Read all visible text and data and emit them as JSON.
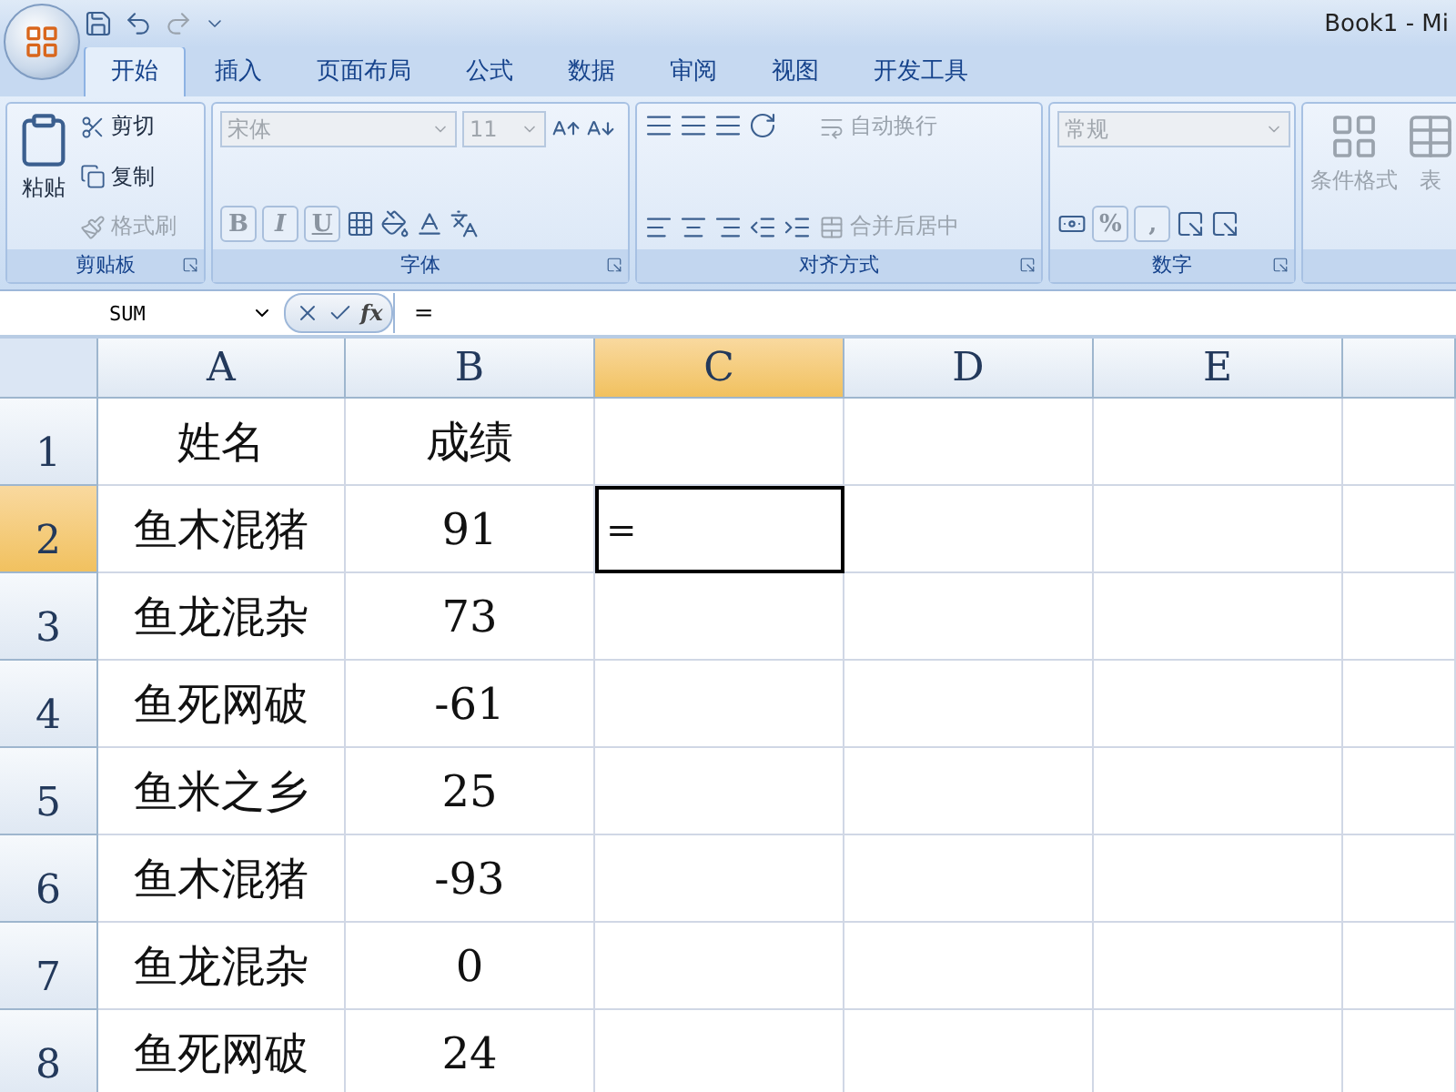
{
  "window": {
    "title": "Book1 - Mi"
  },
  "ribbon": {
    "tabs": [
      {
        "label": "开始",
        "selected": true
      },
      {
        "label": "插入",
        "selected": false
      },
      {
        "label": "页面布局",
        "selected": false
      },
      {
        "label": "公式",
        "selected": false
      },
      {
        "label": "数据",
        "selected": false
      },
      {
        "label": "审阅",
        "selected": false
      },
      {
        "label": "视图",
        "selected": false
      },
      {
        "label": "开发工具",
        "selected": false
      }
    ],
    "groups": [
      {
        "kind": "clipboard",
        "label": "剪贴板",
        "paste": "粘贴",
        "items": [
          {
            "label": "剪切",
            "disabled": false
          },
          {
            "label": "复制",
            "disabled": false
          },
          {
            "label": "格式刷",
            "disabled": true
          }
        ]
      },
      {
        "kind": "font",
        "label": "字体",
        "font": "宋体",
        "size": "11",
        "buttons": [
          "B",
          "I",
          "U"
        ],
        "disabled": true
      },
      {
        "kind": "alignment",
        "label": "对齐方式",
        "items": [
          {
            "label": "自动换行",
            "disabled": true
          },
          {
            "label": "合并后居中",
            "disabled": true
          }
        ]
      },
      {
        "kind": "number",
        "label": "数字",
        "format": "常规",
        "buttons": [
          "%",
          ","
        ],
        "disabled": true
      },
      {
        "kind": "styles",
        "items": [
          {
            "label": "条件格式",
            "disabled": true
          },
          {
            "label": "表",
            "disabled": true
          }
        ]
      }
    ]
  },
  "formula_bar": {
    "name_box": "SUM",
    "function_button": "fx",
    "value": "="
  },
  "sheet": {
    "columns": [
      {
        "label": "A",
        "selected": false
      },
      {
        "label": "B",
        "selected": false
      },
      {
        "label": "C",
        "selected": true
      },
      {
        "label": "D",
        "selected": false
      },
      {
        "label": "E",
        "selected": false
      }
    ],
    "rows": [
      {
        "number": "1",
        "selected": false,
        "cells": [
          "姓名",
          "成绩"
        ]
      },
      {
        "number": "2",
        "selected": true,
        "cells": [
          "鱼木混猪",
          "91",
          "="
        ]
      },
      {
        "number": "3",
        "selected": false,
        "cells": [
          "鱼龙混杂",
          "73"
        ]
      },
      {
        "number": "4",
        "selected": false,
        "cells": [
          "鱼死网破",
          "-61"
        ]
      },
      {
        "number": "5",
        "selected": false,
        "cells": [
          "鱼米之乡",
          "25"
        ]
      },
      {
        "number": "6",
        "selected": false,
        "cells": [
          "鱼木混猪",
          "-93"
        ]
      },
      {
        "number": "7",
        "selected": false,
        "cells": [
          "鱼龙混杂",
          "0"
        ]
      },
      {
        "number": "8",
        "selected": false,
        "cells": [
          "鱼死网破",
          "24"
        ]
      }
    ]
  }
}
